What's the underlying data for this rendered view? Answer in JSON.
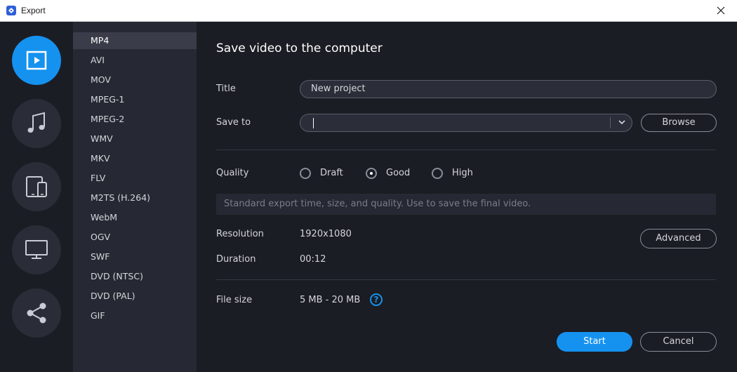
{
  "window": {
    "title": "Export"
  },
  "rail": {
    "items": [
      {
        "icon": "video-file-icon",
        "active": true
      },
      {
        "icon": "music-note-icon",
        "active": false
      },
      {
        "icon": "devices-icon",
        "active": false
      },
      {
        "icon": "monitor-icon",
        "active": false
      },
      {
        "icon": "share-icon",
        "active": false
      }
    ]
  },
  "formats": {
    "selected": "MP4",
    "items": [
      "MP4",
      "AVI",
      "MOV",
      "MPEG-1",
      "MPEG-2",
      "WMV",
      "MKV",
      "FLV",
      "M2TS (H.264)",
      "WebM",
      "OGV",
      "SWF",
      "DVD (NTSC)",
      "DVD (PAL)",
      "GIF"
    ]
  },
  "content": {
    "heading": "Save video to the computer",
    "title_label": "Title",
    "title_value": "New project",
    "save_to_label": "Save to",
    "save_to_value": "",
    "browse_label": "Browse",
    "quality_label": "Quality",
    "quality_options": [
      "Draft",
      "Good",
      "High"
    ],
    "quality_selected": "Good",
    "quality_hint": "Standard export time, size, and quality. Use to save the final video.",
    "resolution_label": "Resolution",
    "resolution_value": "1920x1080",
    "advanced_label": "Advanced",
    "duration_label": "Duration",
    "duration_value": "00:12",
    "file_size_label": "File size",
    "file_size_value": "5 MB - 20 MB",
    "help_glyph": "?",
    "start_label": "Start",
    "cancel_label": "Cancel"
  },
  "colors": {
    "accent": "#1592f0",
    "background": "#1b1d24",
    "panel": "#262933"
  }
}
